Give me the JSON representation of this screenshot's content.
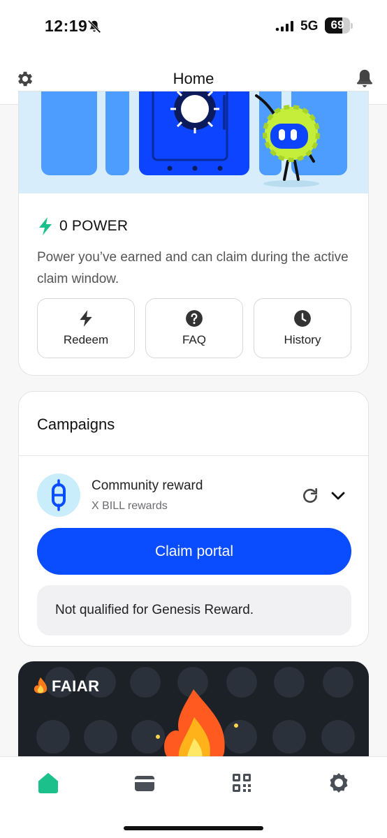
{
  "status_bar": {
    "time": "12:19",
    "network": "5G",
    "battery": "69",
    "battery_level_percent": 69
  },
  "header": {
    "title": "Home"
  },
  "power_card": {
    "power_label": "0 POWER",
    "description": "Power you’ve earned and can claim during the active claim window.",
    "actions": [
      {
        "label": "Redeem",
        "icon": "bolt-icon"
      },
      {
        "label": "FAQ",
        "icon": "question-icon"
      },
      {
        "label": "History",
        "icon": "clock-icon"
      }
    ]
  },
  "campaigns": {
    "title": "Campaigns",
    "reward": {
      "title": "Community reward",
      "subtitle": "X BILL rewards",
      "claim_label": "Claim portal",
      "note": "Not qualified for Genesis Reward."
    }
  },
  "promo": {
    "brand": "FAIAR"
  },
  "colors": {
    "accent": "#0a4cff",
    "green": "#1bc08a",
    "dark_card": "#1c2128"
  },
  "nav": [
    "home-icon",
    "wallet-icon",
    "qr-icon",
    "settings-icon"
  ]
}
